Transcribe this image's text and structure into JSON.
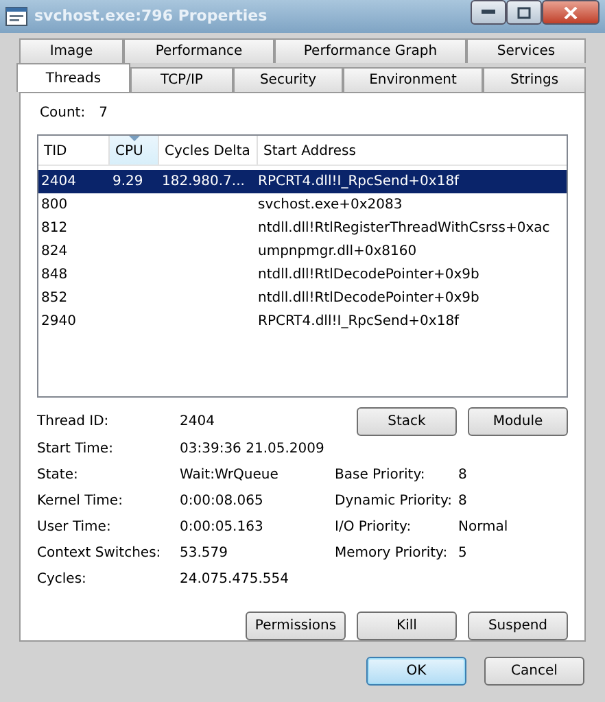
{
  "window": {
    "title": "svchost.exe:796 Properties"
  },
  "tab_rows": [
    [
      {
        "label": "Image",
        "selected": false
      },
      {
        "label": "Performance",
        "selected": false
      },
      {
        "label": "Performance Graph",
        "selected": false
      },
      {
        "label": "Services",
        "selected": false
      }
    ],
    [
      {
        "label": "Threads",
        "selected": true
      },
      {
        "label": "TCP/IP",
        "selected": false
      },
      {
        "label": "Security",
        "selected": false
      },
      {
        "label": "Environment",
        "selected": false
      },
      {
        "label": "Strings",
        "selected": false
      }
    ]
  ],
  "count": {
    "label": "Count:",
    "value": "7"
  },
  "threads": {
    "columns": [
      {
        "label": "TID",
        "sorted": false
      },
      {
        "label": "CPU",
        "sorted": true
      },
      {
        "label": "Cycles Delta",
        "sorted": false
      },
      {
        "label": "Start Address",
        "sorted": false
      }
    ],
    "rows": [
      {
        "cells": [
          "2404",
          "9.29",
          "182.980.7...",
          "RPCRT4.dll!I_RpcSend+0x18f"
        ],
        "selected": true
      },
      {
        "cells": [
          "800",
          "",
          "",
          "svchost.exe+0x2083"
        ],
        "selected": false
      },
      {
        "cells": [
          "812",
          "",
          "",
          "ntdll.dll!RtlRegisterThreadWithCsrss+0xac"
        ],
        "selected": false
      },
      {
        "cells": [
          "824",
          "",
          "",
          "umpnpmgr.dll+0x8160"
        ],
        "selected": false
      },
      {
        "cells": [
          "848",
          "",
          "",
          "ntdll.dll!RtlDecodePointer+0x9b"
        ],
        "selected": false
      },
      {
        "cells": [
          "852",
          "",
          "",
          "ntdll.dll!RtlDecodePointer+0x9b"
        ],
        "selected": false
      },
      {
        "cells": [
          "2940",
          "",
          "",
          "RPCRT4.dll!I_RpcSend+0x18f"
        ],
        "selected": false
      }
    ]
  },
  "details_left": [
    {
      "label": "Thread ID:",
      "value": "2404"
    },
    {
      "label": "Start Time:",
      "value": "03:39:36   21.05.2009"
    },
    {
      "label": "State:",
      "value": "Wait:WrQueue"
    },
    {
      "label": "Kernel Time:",
      "value": "0:00:08.065"
    },
    {
      "label": "User Time:",
      "value": "0:00:05.163"
    },
    {
      "label": "Context Switches:",
      "value": "53.579"
    },
    {
      "label": "Cycles:",
      "value": "24.075.475.554"
    }
  ],
  "details_right": [
    {
      "label": "Base Priority:",
      "value": "8"
    },
    {
      "label": "Dynamic Priority:",
      "value": "8"
    },
    {
      "label": "I/O Priority:",
      "value": "Normal"
    },
    {
      "label": "Memory Priority:",
      "value": "5"
    }
  ],
  "thread_buttons": [
    "Stack",
    "Module"
  ],
  "action_buttons": [
    "Permissions",
    "Kill",
    "Suspend"
  ],
  "dialog_buttons": [
    {
      "label": "OK",
      "default": true
    },
    {
      "label": "Cancel",
      "default": false
    }
  ]
}
